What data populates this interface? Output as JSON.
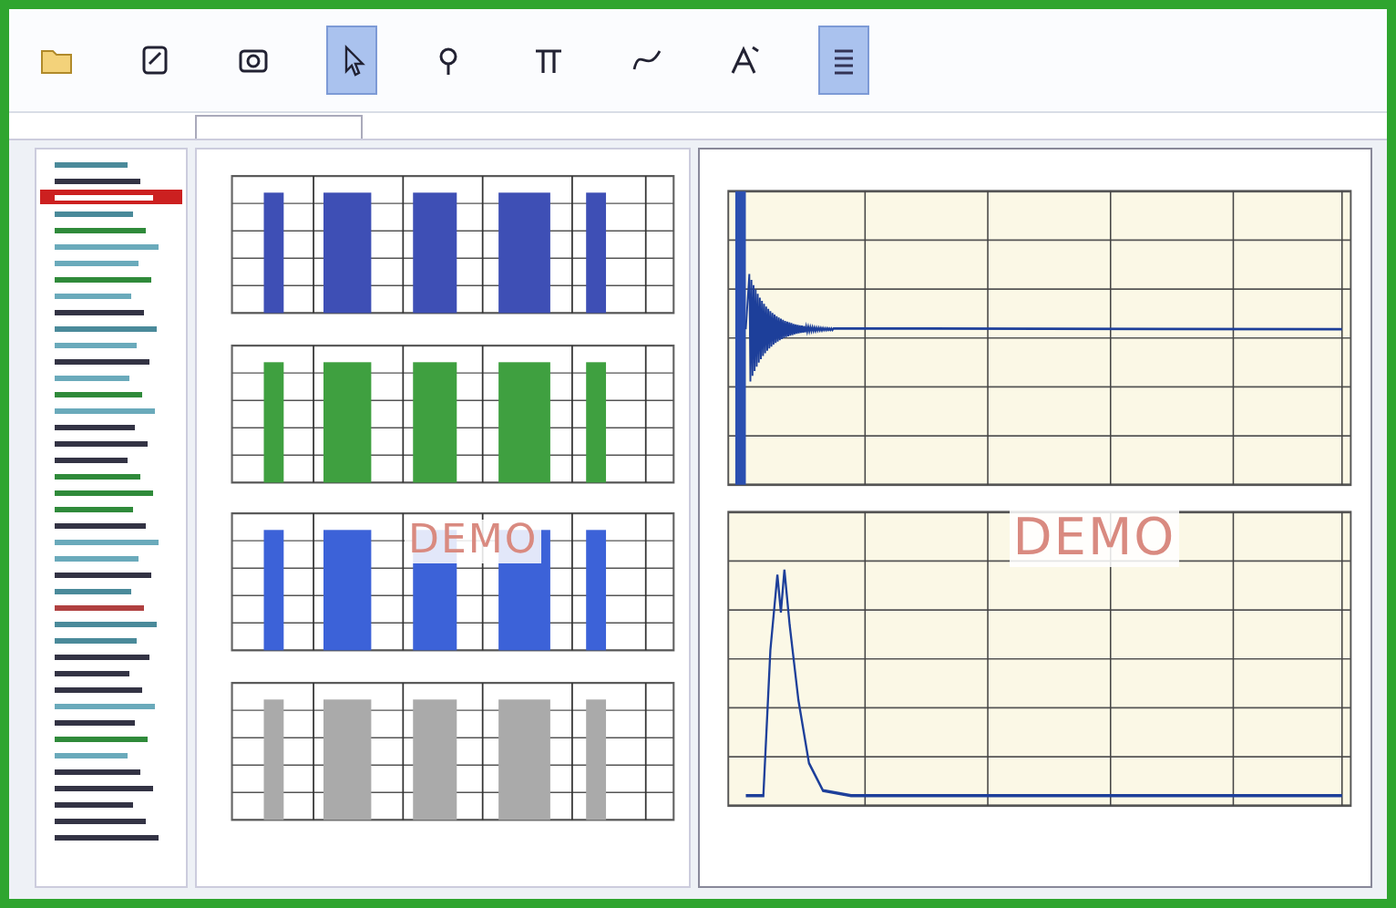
{
  "ribbon": {
    "tools": [
      {
        "kind": "folder",
        "selected": false
      },
      {
        "kind": "note",
        "selected": false
      },
      {
        "kind": "camera",
        "selected": false
      },
      {
        "kind": "pointer",
        "selected": true
      },
      {
        "kind": "magnifier",
        "selected": false
      },
      {
        "kind": "pi",
        "selected": false
      },
      {
        "kind": "curve",
        "selected": false
      },
      {
        "kind": "letter",
        "selected": false
      },
      {
        "kind": "list",
        "selected": true
      }
    ]
  },
  "tree": {
    "items": [
      {
        "color": "#4a8a9a",
        "selected": false
      },
      {
        "color": "#333344",
        "selected": false
      },
      {
        "color": "#ffffff",
        "selected": true
      },
      {
        "color": "#4a8a9a",
        "selected": false
      },
      {
        "color": "#2f8a3a",
        "selected": false
      },
      {
        "color": "#6aaabb",
        "selected": false
      },
      {
        "color": "#6aaabb",
        "selected": false
      },
      {
        "color": "#2f8a3a",
        "selected": false
      },
      {
        "color": "#6aaabb",
        "selected": false
      },
      {
        "color": "#333344",
        "selected": false
      },
      {
        "color": "#4a8a9a",
        "selected": false
      },
      {
        "color": "#6aaabb",
        "selected": false
      },
      {
        "color": "#333344",
        "selected": false
      },
      {
        "color": "#6aaabb",
        "selected": false
      },
      {
        "color": "#2f8a3a",
        "selected": false
      },
      {
        "color": "#6aaabb",
        "selected": false
      },
      {
        "color": "#333344",
        "selected": false
      },
      {
        "color": "#333344",
        "selected": false
      },
      {
        "color": "#333344",
        "selected": false
      },
      {
        "color": "#2f8a3a",
        "selected": false
      },
      {
        "color": "#2f8a3a",
        "selected": false
      },
      {
        "color": "#2f8a3a",
        "selected": false
      },
      {
        "color": "#333344",
        "selected": false
      },
      {
        "color": "#6aaabb",
        "selected": false
      },
      {
        "color": "#6aaabb",
        "selected": false
      },
      {
        "color": "#333344",
        "selected": false
      },
      {
        "color": "#4a8a9a",
        "selected": false
      },
      {
        "color": "#b04040",
        "selected": false
      },
      {
        "color": "#4a8a9a",
        "selected": false
      },
      {
        "color": "#4a8a9a",
        "selected": false
      },
      {
        "color": "#333344",
        "selected": false
      },
      {
        "color": "#333344",
        "selected": false
      },
      {
        "color": "#333344",
        "selected": false
      },
      {
        "color": "#6aaabb",
        "selected": false
      },
      {
        "color": "#333344",
        "selected": false
      },
      {
        "color": "#2f8a3a",
        "selected": false
      },
      {
        "color": "#6aaabb",
        "selected": false
      },
      {
        "color": "#333344",
        "selected": false
      },
      {
        "color": "#333344",
        "selected": false
      },
      {
        "color": "#333344",
        "selected": false
      },
      {
        "color": "#333344",
        "selected": false
      },
      {
        "color": "#333344",
        "selected": false
      }
    ]
  },
  "bar_panel": {
    "charts": [
      {
        "color": "#3e4fb5"
      },
      {
        "color": "#3fa040"
      },
      {
        "color": "#3c62d8",
        "watermark": "DEMO"
      },
      {
        "color": "#aaaaaa"
      }
    ]
  },
  "wave_panel": {
    "charts": [
      {
        "kind": "decay"
      },
      {
        "kind": "peak",
        "watermark": "DEMO"
      }
    ]
  }
}
